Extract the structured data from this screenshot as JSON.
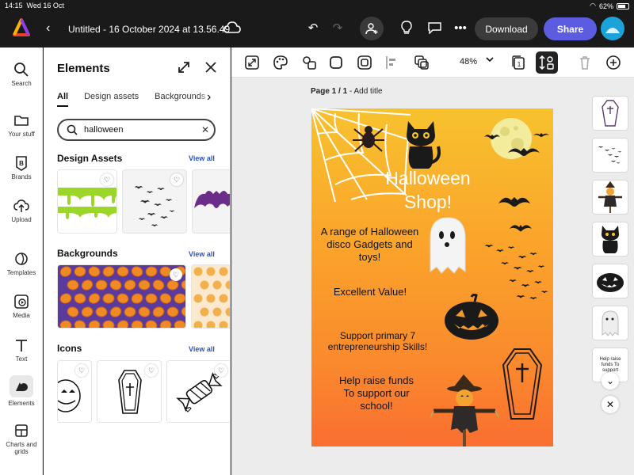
{
  "status_bar": {
    "time": "14:15",
    "date": "Wed 16 Oct",
    "battery": "62%"
  },
  "top_bar": {
    "document_title": "Untitled - 16 October 2024 at 13.56.49",
    "download_label": "Download",
    "share_label": "Share"
  },
  "rail": {
    "items": [
      {
        "label": "Search"
      },
      {
        "label": "Your stuff"
      },
      {
        "label": "Brands"
      },
      {
        "label": "Upload"
      },
      {
        "label": "Templates"
      },
      {
        "label": "Media"
      },
      {
        "label": "Text"
      },
      {
        "label": "Elements"
      },
      {
        "label": "Charts and grids"
      }
    ]
  },
  "panel": {
    "title": "Elements",
    "tabs": [
      {
        "label": "All"
      },
      {
        "label": "Design assets"
      },
      {
        "label": "Backgrounds"
      }
    ],
    "search": {
      "value": "halloween",
      "placeholder": "Search"
    },
    "sections": [
      {
        "title": "Design Assets",
        "view_all": "View all"
      },
      {
        "title": "Backgrounds",
        "view_all": "View all"
      },
      {
        "title": "Icons",
        "view_all": "View all"
      }
    ]
  },
  "canvas": {
    "zoom": "48%",
    "page_label": "Page 1 / 1",
    "add_title": "Add title",
    "heading": "Halloween Shop!",
    "text_blocks": [
      "A range of Halloween disco Gadgets and toys!",
      "Excellent Value!",
      "Support primary 7 entrepreneurship Skills!",
      "Help raise funds To support our school!"
    ]
  },
  "page_thumbs": {
    "text_thumb": "Help raise funds To support"
  },
  "colors": {
    "accent": "#5c5ce0",
    "avatar": "#1ba3d9",
    "link": "#2a52be"
  }
}
